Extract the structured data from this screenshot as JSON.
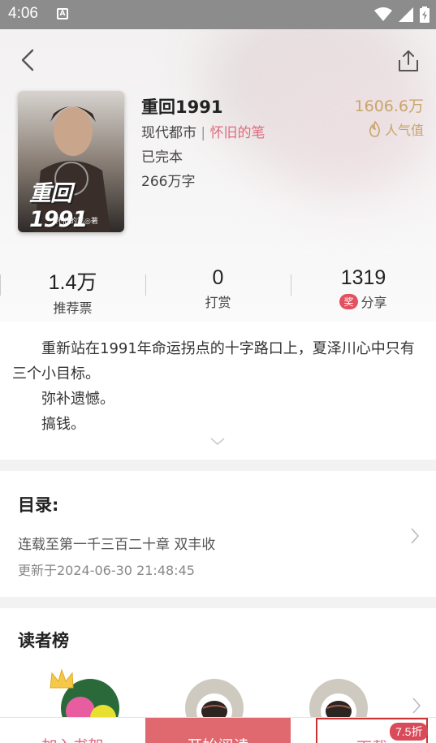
{
  "status_bar": {
    "time": "4:06",
    "notification_icon": "A"
  },
  "header": {
    "back_icon": "chevron-left-icon",
    "share_icon": "share-icon"
  },
  "book": {
    "title": "重回1991",
    "category": "现代都市",
    "separator": "|",
    "author": "怀旧的笔",
    "status": "已完本",
    "word_count": "266万字",
    "cover_title": "重回1991",
    "cover_author": "怀旧的笔◎著",
    "popularity_value": "1606.6万",
    "popularity_label": "人气值"
  },
  "stats": [
    {
      "value": "1.4万",
      "label": "推荐票"
    },
    {
      "value": "0",
      "label": "打赏"
    },
    {
      "value": "1319",
      "label": "分享",
      "badge": "奖"
    }
  ],
  "description": {
    "lines": [
      "　　重新站在1991年命运拐点的十字路口上，夏泽川心中只有三个小目标。",
      "　　弥补遗憾。",
      "　　搞钱。"
    ]
  },
  "catalog": {
    "title": "目录:",
    "latest_chapter": "连载至第一千三百二十章 双丰收",
    "updated": "更新于2024-06-30 21:48:45"
  },
  "readers": {
    "title": "读者榜"
  },
  "bottom_bar": {
    "add_shelf": "加入书架",
    "start_reading": "开始阅读",
    "download": "下载",
    "discount": "7.5折"
  },
  "colors": {
    "accent": "#e06a7c",
    "gold": "#c9a56a",
    "read_button": "#e0686f"
  }
}
